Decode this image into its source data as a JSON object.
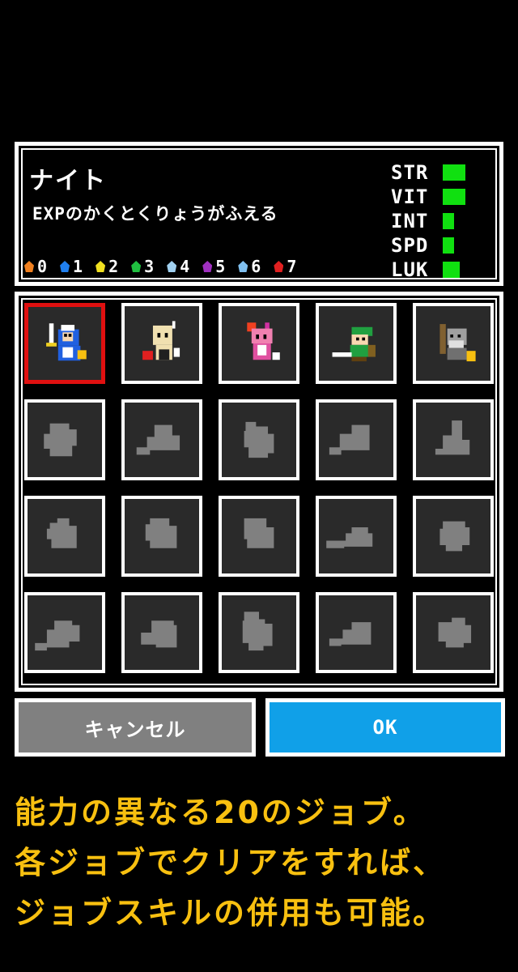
{
  "info": {
    "job_name": "ナイト",
    "job_desc": "EXPのかくとくりょうがふえる",
    "elements": [
      {
        "icon": "fire-icon",
        "color": "#f08020",
        "value": "0"
      },
      {
        "icon": "water-icon",
        "color": "#2080f0",
        "value": "1"
      },
      {
        "icon": "thunder-icon",
        "color": "#f0e020",
        "value": "2"
      },
      {
        "icon": "leaf-icon",
        "color": "#20c040",
        "value": "3"
      },
      {
        "icon": "wind-icon",
        "color": "#a0d0f0",
        "value": "4"
      },
      {
        "icon": "poison-icon",
        "color": "#a030c0",
        "value": "5"
      },
      {
        "icon": "ice-icon",
        "color": "#80c0f0",
        "value": "6"
      },
      {
        "icon": "blood-icon",
        "color": "#e02020",
        "value": "7"
      }
    ],
    "stats": [
      {
        "label": "STR",
        "level": 4
      },
      {
        "label": "VIT",
        "level": 4
      },
      {
        "label": "INT",
        "level": 2
      },
      {
        "label": "SPD",
        "level": 2
      },
      {
        "label": "LUK",
        "level": 3
      }
    ]
  },
  "jobs": [
    {
      "name": "knight",
      "unlocked": true,
      "selected": true
    },
    {
      "name": "monk",
      "unlocked": true,
      "selected": false
    },
    {
      "name": "dancer",
      "unlocked": true,
      "selected": false
    },
    {
      "name": "swordsman",
      "unlocked": true,
      "selected": false
    },
    {
      "name": "old-warrior",
      "unlocked": true,
      "selected": false
    },
    {
      "name": "locked",
      "unlocked": false
    },
    {
      "name": "locked",
      "unlocked": false
    },
    {
      "name": "locked",
      "unlocked": false
    },
    {
      "name": "locked",
      "unlocked": false
    },
    {
      "name": "locked",
      "unlocked": false
    },
    {
      "name": "locked",
      "unlocked": false
    },
    {
      "name": "locked",
      "unlocked": false
    },
    {
      "name": "locked",
      "unlocked": false
    },
    {
      "name": "locked",
      "unlocked": false
    },
    {
      "name": "locked",
      "unlocked": false
    },
    {
      "name": "locked",
      "unlocked": false
    },
    {
      "name": "locked",
      "unlocked": false
    },
    {
      "name": "locked",
      "unlocked": false
    },
    {
      "name": "locked",
      "unlocked": false
    },
    {
      "name": "locked",
      "unlocked": false
    }
  ],
  "buttons": {
    "cancel": "キャンセル",
    "ok": "OK"
  },
  "caption": {
    "line1": "能力の異なる20のジョブ。",
    "line2": "各ジョブでクリアをすれば、",
    "line3": "ジョブスキルの併用も可能。"
  },
  "colors": {
    "stat_bar": "#10e010",
    "selected_border": "#e01010",
    "cancel_bg": "#808080",
    "ok_bg": "#10a0e8",
    "caption": "#f8c010"
  }
}
